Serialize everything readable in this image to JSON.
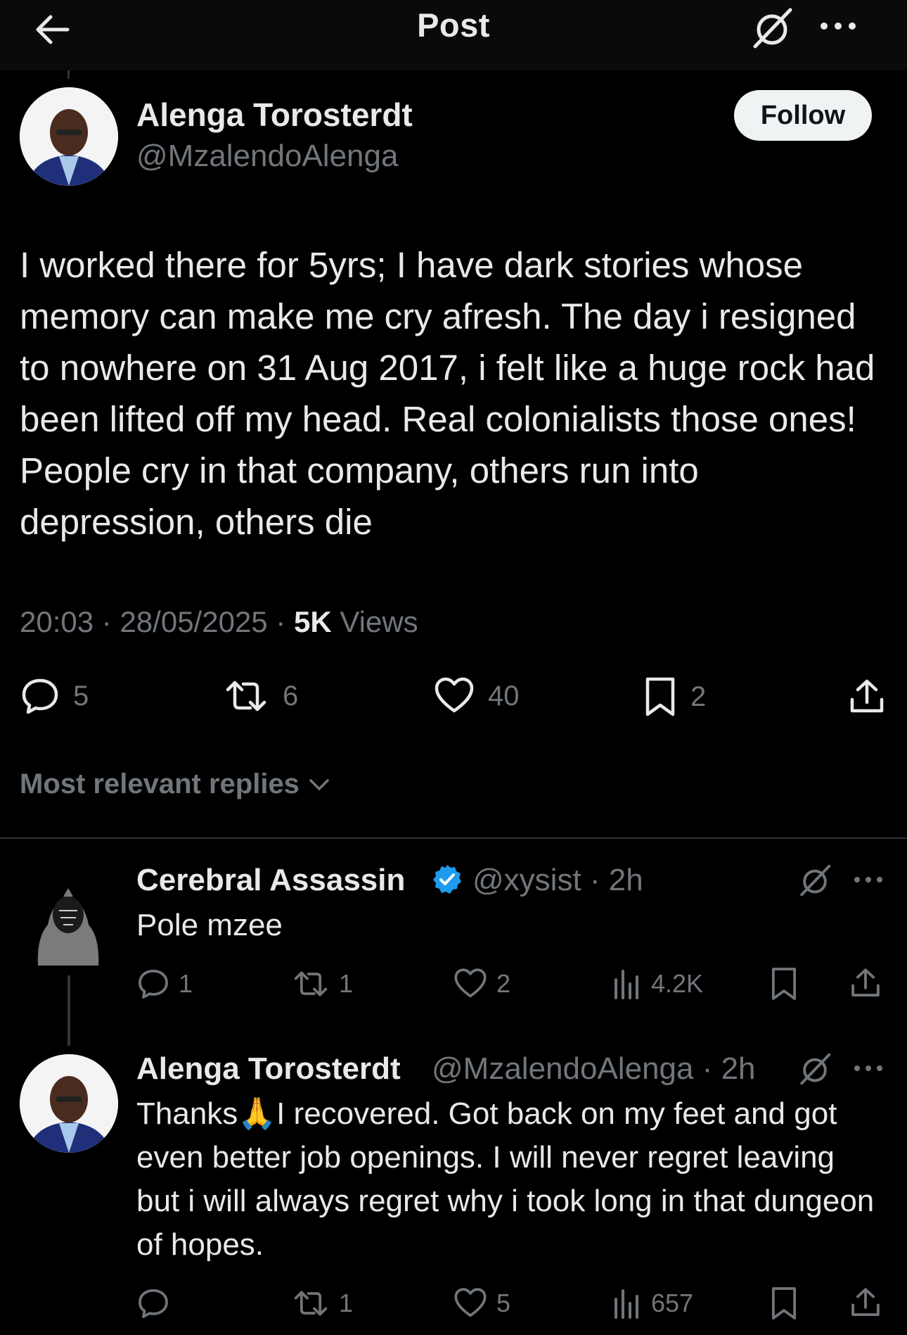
{
  "header": {
    "title": "Post"
  },
  "post": {
    "author_name": "Alenga Torosterdt",
    "author_handle": "@MzalendoAlenga",
    "follow_label": "Follow",
    "text": "I worked there for 5yrs; I have dark stories whose memory can make me cry afresh. The day i resigned to nowhere on 31 Aug 2017, i felt like a huge rock had been lifted off my head. Real colonialists those ones! People cry in that company, others run into depression, others die",
    "time": "20:03",
    "date": "28/05/2025",
    "views_count": "5K",
    "views_label": "Views",
    "replies": "5",
    "reposts": "6",
    "likes": "40",
    "bookmarks": "2"
  },
  "sort": {
    "label": "Most relevant replies"
  },
  "replies": [
    {
      "name": "Cerebral Assassin",
      "verified": true,
      "handle": "@xysist",
      "age": "· 2h",
      "text": "Pole mzee",
      "replies": "1",
      "reposts": "1",
      "likes": "2",
      "views": "4.2K"
    },
    {
      "name": "Alenga Torosterdt",
      "handle": "@MzalendoAlenga",
      "age": "· 2h",
      "text_before": "Thanks",
      "emoji": "🙏",
      "text_after": "I recovered. Got back on my feet and got even better job openings. I will never regret leaving but i will always regret why i took long in that dungeon of hopes.",
      "replies": "",
      "reposts": "1",
      "likes": "5",
      "views": "657"
    }
  ],
  "colors": {
    "background": "#000000",
    "muted": "#71767b",
    "text": "#e7e9ea",
    "verified": "#1d9bf0"
  }
}
